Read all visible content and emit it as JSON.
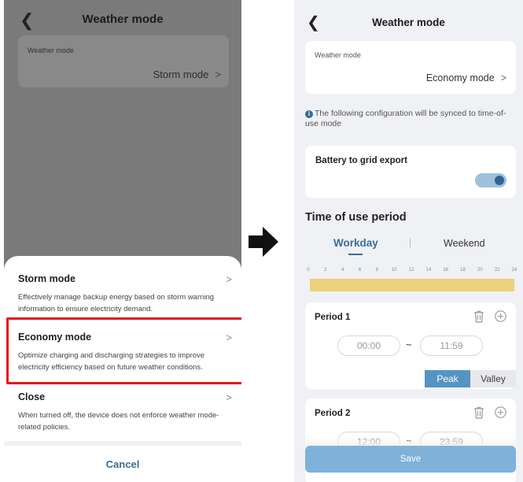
{
  "left": {
    "header": {
      "back_icon": "chevron-left-icon",
      "title": "Weather mode"
    },
    "mode_card": {
      "label": "Weather mode",
      "value": "Storm mode"
    },
    "sheet": {
      "options": [
        {
          "title": "Storm mode",
          "description": "Effectively manage backup energy based on storm warning information to ensure electricity demand."
        },
        {
          "title": "Economy mode",
          "description": "Optimize charging and discharging strategies to improve electricity efficiency based on future weather conditions."
        },
        {
          "title": "Close",
          "description": "When turned off, the device does not enforce weather mode-related policies."
        }
      ],
      "cancel_label": "Cancel",
      "highlight_color": "#e8161b"
    }
  },
  "arrow_icon": "right-arrow-icon",
  "right": {
    "header": {
      "back_icon": "chevron-left-icon",
      "title": "Weather mode"
    },
    "mode_card": {
      "label": "Weather mode",
      "value": "Economy mode"
    },
    "info_text": "The following configuration will be synced to time-of-use mode",
    "battery_export": {
      "label": "Battery to grid export",
      "enabled": true
    },
    "time_of_use": {
      "title": "Time of use period",
      "tabs": [
        {
          "label": "Workday",
          "active": true
        },
        {
          "label": "Weekend",
          "active": false
        }
      ],
      "ticks": [
        "0",
        "2",
        "4",
        "6",
        "8",
        "10",
        "12",
        "14",
        "16",
        "18",
        "20",
        "22",
        "24"
      ],
      "bar_color": "#ecd17a"
    },
    "periods": [
      {
        "title": "Period 1",
        "start": "00:00",
        "end": "11:59",
        "separator": "~",
        "options": [
          "Peak",
          "Valley"
        ],
        "selected": "Peak"
      },
      {
        "title": "Period 2",
        "start": "12:00",
        "end": "23:59",
        "separator": "~"
      }
    ],
    "save_label": "Save",
    "accent_color": "#3b6d96"
  }
}
